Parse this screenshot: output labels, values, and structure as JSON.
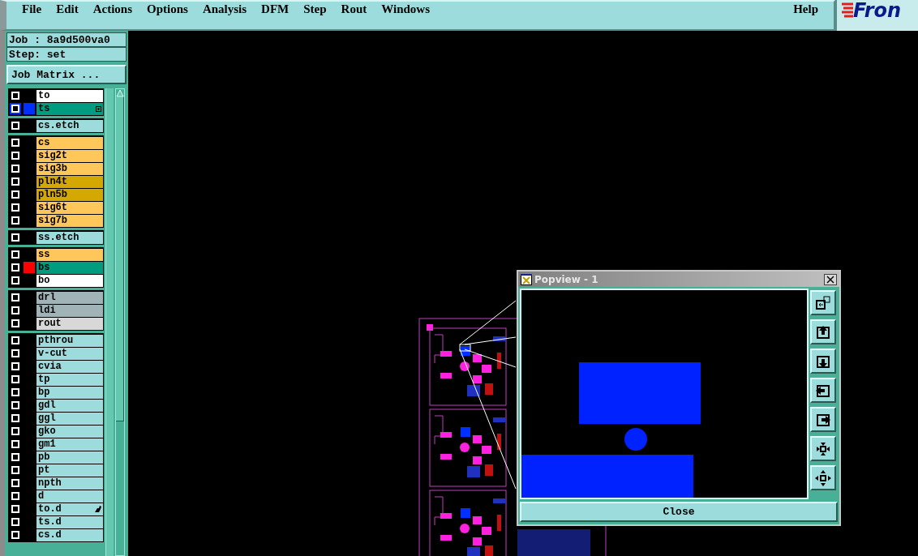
{
  "menu_bar": {
    "items": [
      "File",
      "Edit",
      "Actions",
      "Options",
      "Analysis",
      "DFM",
      "Step",
      "Rout",
      "Windows"
    ],
    "help": "Help",
    "logo": "Fron"
  },
  "job": {
    "job_label": "Job : 8a9d500va0",
    "step_label": "Step: set",
    "matrix_button": "Job Matrix ..."
  },
  "layer_groups": [
    {
      "layers": [
        {
          "name": "to",
          "kind": "board",
          "work_layer": false
        },
        {
          "name": "ts",
          "kind": "mask",
          "work_layer": true,
          "color": "#0030ff",
          "plus_box": true
        }
      ]
    },
    {
      "layers": [
        {
          "name": "cs.etch",
          "kind": "misc",
          "work_layer": false
        }
      ]
    },
    {
      "layers": [
        {
          "name": "cs",
          "kind": "signal",
          "work_layer": false
        },
        {
          "name": "sig2t",
          "kind": "signal",
          "work_layer": false
        },
        {
          "name": "sig3b",
          "kind": "signal",
          "work_layer": false
        },
        {
          "name": "pln4t",
          "kind": "power",
          "work_layer": false
        },
        {
          "name": "pln5b",
          "kind": "power",
          "work_layer": false
        },
        {
          "name": "sig6t",
          "kind": "signal",
          "work_layer": false
        },
        {
          "name": "sig7b",
          "kind": "signal",
          "work_layer": false
        }
      ]
    },
    {
      "layers": [
        {
          "name": "ss.etch",
          "kind": "misc",
          "work_layer": false
        }
      ]
    },
    {
      "layers": [
        {
          "name": "ss",
          "kind": "signal",
          "work_layer": false
        },
        {
          "name": "bs",
          "kind": "mask",
          "work_layer": false,
          "color": "#ff0000"
        },
        {
          "name": "bo",
          "kind": "board",
          "work_layer": false
        }
      ]
    },
    {
      "layers": [
        {
          "name": "drl",
          "kind": "drill",
          "work_layer": false
        },
        {
          "name": "ldi",
          "kind": "drill",
          "work_layer": false
        },
        {
          "name": "rout",
          "kind": "rout",
          "work_layer": false
        }
      ]
    },
    {
      "layers": [
        {
          "name": "pthrou",
          "kind": "misc",
          "work_layer": false
        },
        {
          "name": "v-cut",
          "kind": "misc",
          "work_layer": false
        },
        {
          "name": "cvia",
          "kind": "misc",
          "work_layer": false
        },
        {
          "name": "tp",
          "kind": "misc",
          "work_layer": false
        },
        {
          "name": "bp",
          "kind": "misc",
          "work_layer": false
        },
        {
          "name": "gdl",
          "kind": "misc",
          "work_layer": false
        },
        {
          "name": "ggl",
          "kind": "misc",
          "work_layer": false
        },
        {
          "name": "gko",
          "kind": "misc",
          "work_layer": false
        },
        {
          "name": "gm1",
          "kind": "misc",
          "work_layer": false
        },
        {
          "name": "pb",
          "kind": "misc",
          "work_layer": false
        },
        {
          "name": "pt",
          "kind": "misc",
          "work_layer": false
        },
        {
          "name": "npth",
          "kind": "misc",
          "work_layer": false
        },
        {
          "name": "d",
          "kind": "misc",
          "work_layer": false
        },
        {
          "name": "to.d",
          "kind": "misc",
          "work_layer": false,
          "hand": true
        },
        {
          "name": "ts.d",
          "kind": "misc",
          "work_layer": false
        },
        {
          "name": "cs.d",
          "kind": "misc",
          "work_layer": false
        }
      ]
    }
  ],
  "popview": {
    "title": "Popview - 1",
    "close_button": "Close"
  }
}
